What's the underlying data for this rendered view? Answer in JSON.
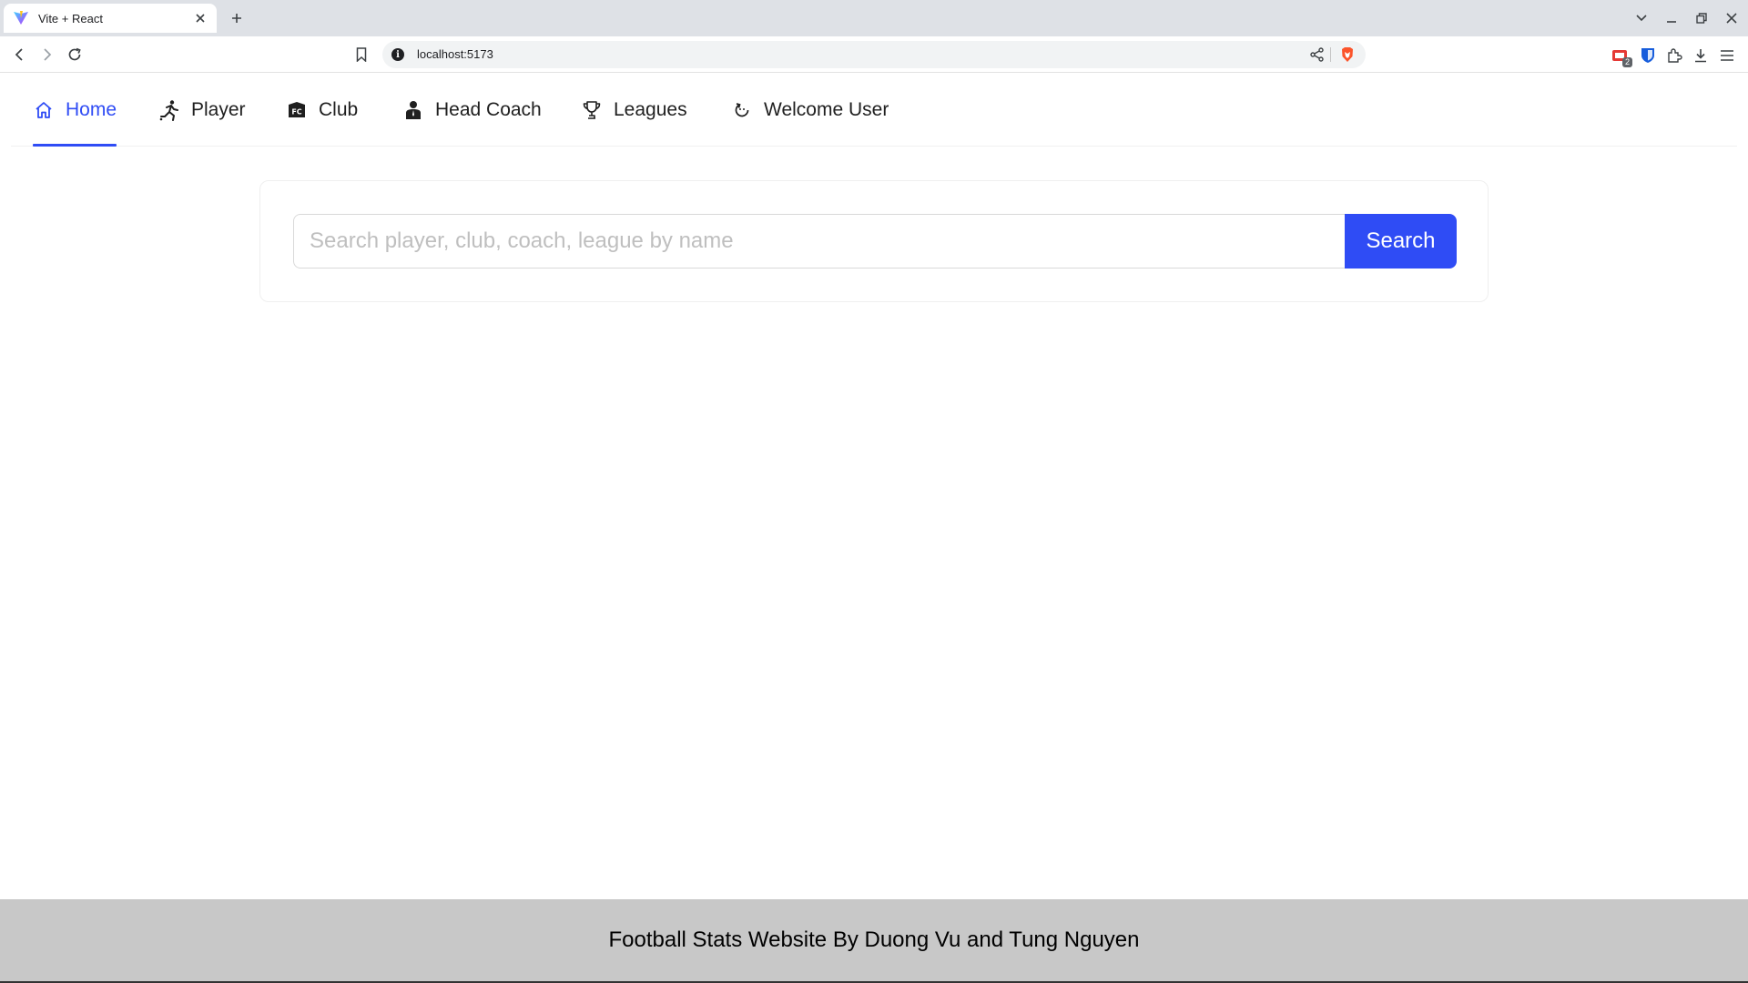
{
  "browser": {
    "tab_title": "Vite + React",
    "url": "localhost:5173",
    "extension_badge_count": "2",
    "icons": [
      "vite-favicon",
      "close-icon",
      "plus-icon",
      "chevron-down-icon",
      "minimize-icon",
      "restore-icon",
      "close-window-icon",
      "back-arrow-icon",
      "forward-arrow-icon",
      "reload-icon",
      "bookmark-icon",
      "site-info-icon",
      "share-icon",
      "brave-shields-icon",
      "extension-icon",
      "bitwarden-icon",
      "puzzle-icon",
      "download-icon",
      "menu-icon"
    ]
  },
  "nav": {
    "active_color": "#2f4cf5",
    "items": [
      {
        "label": "Home",
        "icon": "home-icon"
      },
      {
        "label": "Player",
        "icon": "running-player-icon"
      },
      {
        "label": "Club",
        "icon": "club-badge-icon"
      },
      {
        "label": "Head Coach",
        "icon": "coach-icon"
      },
      {
        "label": "Leagues",
        "icon": "trophy-icon"
      },
      {
        "label": "Welcome User",
        "icon": "reload-icon"
      }
    ]
  },
  "search": {
    "placeholder": "Search player, club, coach, league by name",
    "value": "",
    "button_label": "Search"
  },
  "footer": {
    "text": "Football Stats Website By Duong Vu and Tung Nguyen"
  }
}
